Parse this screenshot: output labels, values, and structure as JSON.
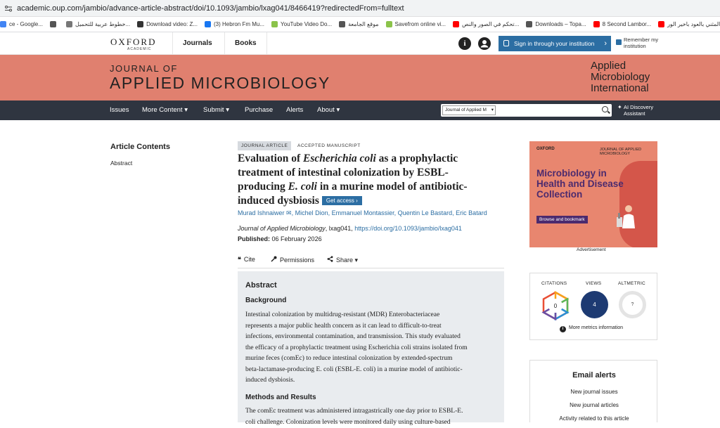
{
  "browser": {
    "url": "academic.oup.com/jambio/advance-article-abstract/doi/10.1093/jambio/lxag041/8466419?redirectedFrom=fulltext",
    "bookmarks": [
      {
        "label": "ce - Google...",
        "color": "#4285f4"
      },
      {
        "label": "",
        "color": "#555555"
      },
      {
        "label": "خطوط عربية للتحميل...",
        "color": "#777777"
      },
      {
        "label": "Download video: Z...",
        "color": "#333333"
      },
      {
        "label": "(3) Hebron Fm Mu...",
        "color": "#1877f2"
      },
      {
        "label": "YouTube Video Do...",
        "color": "#8bc34a"
      },
      {
        "label": "موقع الجامعة",
        "color": "#555555"
      },
      {
        "label": "Savefrom online vi...",
        "color": "#8bc34a"
      },
      {
        "label": "تحكم في الصور والنص...",
        "color": "#ff0000"
      },
      {
        "label": "Downloads – Topa...",
        "color": "#555555"
      },
      {
        "label": "8 Second Lambor...",
        "color": "#ff0000"
      },
      {
        "label": "المثني بالعود باخير الور...",
        "color": "#ff0000"
      }
    ]
  },
  "topnav": {
    "logo_main": "OXFORD",
    "logo_sub": "ACADEMIC",
    "tabs": [
      "Journals",
      "Books"
    ],
    "signin_label": "Sign in through your institution",
    "remember_label": "Remember my institution"
  },
  "banner": {
    "line1": "JOURNAL OF",
    "line2": "APPLIED MICROBIOLOGY",
    "partner": [
      "Applied",
      "Microbiology",
      "International"
    ]
  },
  "mainnav": {
    "items": [
      "Issues",
      "More Content ▾",
      "Submit ▾",
      "Purchase",
      "Alerts",
      "About ▾"
    ],
    "search_scope": "Journal of Applied M",
    "search_placeholder": "",
    "ai_label_1": "AI Discovery",
    "ai_label_2": "Assistant"
  },
  "sidebar": {
    "heading": "Article Contents",
    "items": [
      "Abstract"
    ]
  },
  "article": {
    "badge": "JOURNAL ARTICLE",
    "status": "ACCEPTED MANUSCRIPT",
    "title_parts": [
      "Evaluation of ",
      "Escherichia coli",
      " as a prophylactic treatment of intestinal colonization by ESBL-producing ",
      "E. coli",
      " in a murine model of antibiotic-induced dysbiosis"
    ],
    "get_access": "Get access ›",
    "authors": "Murad Ishnaiwer ✉, Michel Dion, Emmanuel Montassier, Quentin Le Bastard, Eric Batard",
    "journal": "Journal of Applied Microbiology",
    "citation_rest": ", lxag041, ",
    "doi": "https://doi.org/10.1093/jambio/lxag041",
    "published_label": "Published:",
    "published_date": "06 February 2026",
    "tools": [
      "Cite",
      "Permissions",
      "Share ▾"
    ]
  },
  "abstract": {
    "heading": "Abstract",
    "background_heading": "Background",
    "background_lines": [
      "Intestinal colonization by multidrug-resistant (MDR) Enterobacteriaceae",
      "represents a major public health concern as it can lead to difficult-to-treat",
      "infections, environmental contamination, and transmission. This study evaluated",
      "the efficacy of a prophylactic treatment using Escherichia coli strains isolated from",
      "murine feces (comEc) to reduce intestinal colonization by extended-spectrum",
      "beta-lactamase-producing E. coli (ESBL-E. coli) in a murine model of antibiotic-",
      "induced dysbiosis."
    ],
    "methods_heading": "Methods and Results",
    "methods_lines": [
      "The comEc treatment was administered intragastrically one day prior to ESBL-E.",
      "coli challenge. Colonization levels were monitored daily using culture-based"
    ]
  },
  "ad": {
    "publisher": "OXFORD",
    "journal": "JOURNAL OF APPLIED MICROBIOLOGY",
    "headline": "Microbiology in Health and Disease Collection",
    "button": "Browse and bookmark",
    "caption": "Advertisement"
  },
  "metrics": {
    "labels": [
      "CITATIONS",
      "VIEWS",
      "ALTMETRIC"
    ],
    "citations": "0",
    "views": "4",
    "altmetric": "?",
    "more": "More metrics information"
  },
  "email_alerts": {
    "heading": "Email alerts",
    "items": [
      "New journal issues",
      "New journal articles",
      "Activity related to this article"
    ]
  },
  "colors": {
    "banner": "#e0806f",
    "nav": "#2f3540",
    "link": "#2c6ea3",
    "abstract_bg": "#e9ecef"
  }
}
